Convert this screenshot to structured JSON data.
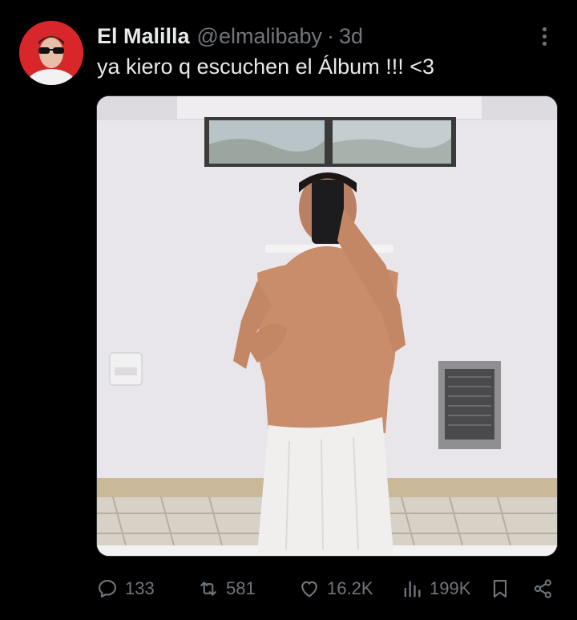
{
  "tweet": {
    "author_name": "El Malilla",
    "handle": "@elmalibaby",
    "separator": "·",
    "time": "3d",
    "text": "ya kiero q escuchen el Álbum !!! <3"
  },
  "actions": {
    "replies": "133",
    "reposts": "581",
    "likes": "16.2K",
    "views": "199K"
  },
  "icons": {
    "reply": "reply-icon",
    "repost": "repost-icon",
    "like": "heart-icon",
    "views": "views-icon",
    "bookmark": "bookmark-icon",
    "share": "share-icon",
    "more": "more-icon"
  },
  "colors": {
    "background": "#000000",
    "text_primary": "#e7e9ea",
    "text_secondary": "#71767b",
    "avatar_bg": "#d9262b"
  }
}
